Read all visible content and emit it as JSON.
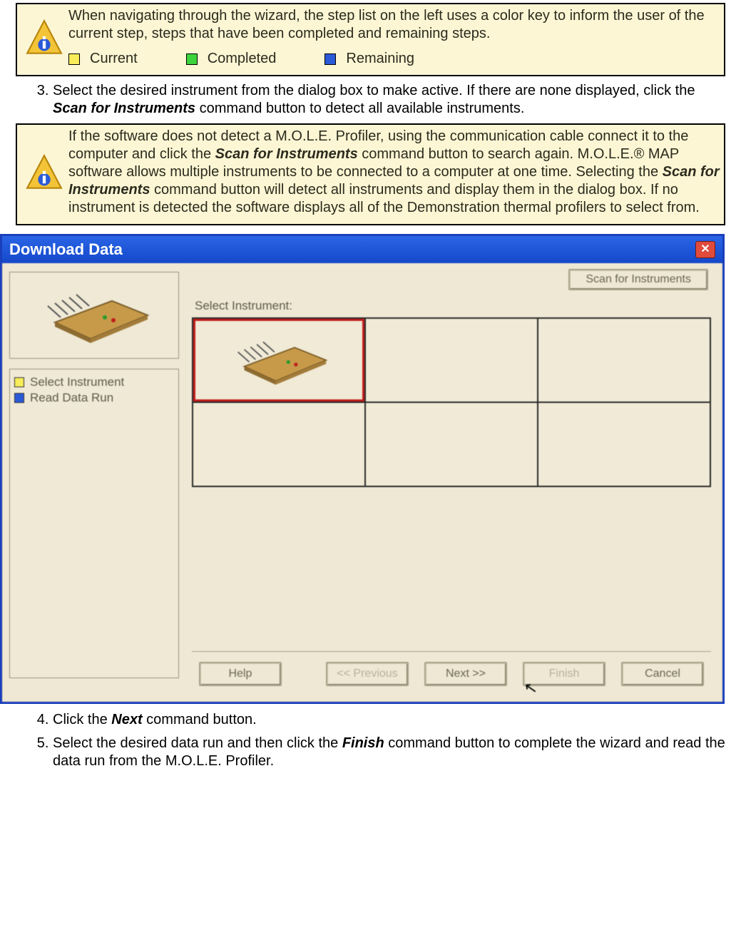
{
  "note1": {
    "text": "When navigating through the wizard, the step list on the left uses a color key to inform the user of the current step, steps that have been completed and remaining steps.",
    "legend": {
      "current": "Current",
      "completed": "Completed",
      "remaining": "Remaining"
    }
  },
  "steps": {
    "s3_a": "Select the desired instrument from the dialog box to make active. If there are none displayed, click the ",
    "s3_b": "Scan for Instruments",
    "s3_c": " command button to detect all available instruments.",
    "s4_a": "Click the ",
    "s4_b": "Next",
    "s4_c": " command button.",
    "s5_a": "Select the desired data run and then click the ",
    "s5_b": "Finish",
    "s5_c": " command button to complete the wizard and read the data run from the M.O.L.E. Profiler."
  },
  "note2": {
    "a": "If the software does not detect a M.O.L.E. Profiler, using the communication cable connect it to the computer and click the ",
    "b": "Scan for Instruments",
    "c": " command button to search again. M.O.L.E.® MAP software allows multiple instruments to be connected to a computer at one time. Selecting the ",
    "d": "Scan for Instruments",
    "e": " command button will detect all instruments and display them in the dialog box. If no instrument is detected the software displays all of the Demonstration thermal profilers to select from."
  },
  "dialog": {
    "title": "Download Data",
    "scan_btn": "Scan for Instruments",
    "select_label": "Select Instrument:",
    "step_list": {
      "s1": "Select Instrument",
      "s2": "Read Data Run"
    },
    "buttons": {
      "help": "Help",
      "back": "<< Previous",
      "next": "Next >>",
      "finish": "Finish",
      "cancel": "Cancel"
    }
  }
}
